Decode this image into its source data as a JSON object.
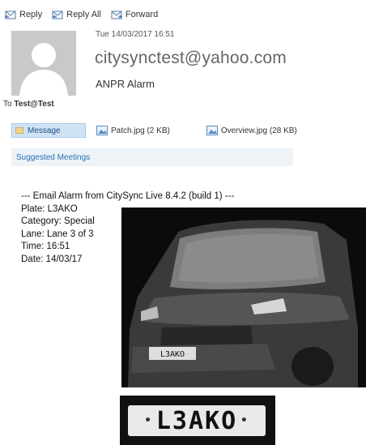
{
  "toolbar": {
    "reply_label": "Reply",
    "reply_all_label": "Reply All",
    "forward_label": "Forward"
  },
  "email": {
    "date": "Tue 14/03/2017 16:51",
    "sender": "citysynctest@yahoo.com",
    "subject": "ANPR Alarm",
    "to_prefix": "To",
    "to_address": "Test@Test"
  },
  "attachments": {
    "message_tab": "Message",
    "items": [
      {
        "label": "Patch.jpg (2 KB)"
      },
      {
        "label": "Overview.jpg (28 KB)"
      }
    ]
  },
  "suggested_meetings": "Suggested Meetings",
  "body": {
    "header": "--- Email Alarm from CitySync Live 8.4.2 (build 1) ---",
    "plate": "Plate: L3AKO",
    "category": "Category: Special",
    "lane": "Lane: Lane 3 of 3",
    "time": "Time: 16:51",
    "date": "Date: 14/03/17"
  },
  "images": {
    "car_plate_text": "L3AKO",
    "patch_plate_text": "L3AKO"
  },
  "colors": {
    "accent_blue": "#2a6fb5",
    "message_tab_bg": "#cfe3f5",
    "suggested_bg": "#eef3f8"
  }
}
